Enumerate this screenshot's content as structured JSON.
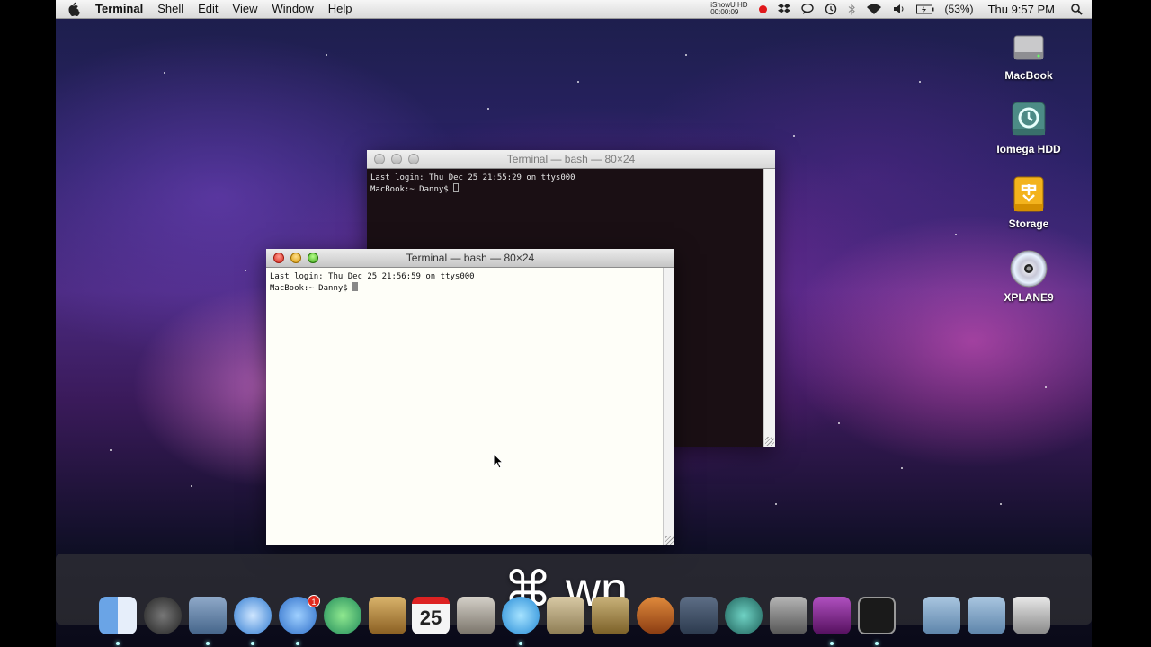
{
  "menubar": {
    "app_name": "Terminal",
    "menus": [
      "Shell",
      "Edit",
      "View",
      "Window",
      "Help"
    ],
    "ishowu_title": "iShowU HD",
    "ishowu_time": "00:00:09",
    "battery": "(53%)",
    "clock": "Thu 9:57 PM"
  },
  "windows": {
    "back": {
      "title": "Terminal — bash — 80×24",
      "lines": [
        "Last login: Thu Dec 25 21:55:29 on ttys000",
        "MacBook:~ Danny$ "
      ]
    },
    "front": {
      "title": "Terminal — bash — 80×24",
      "lines": [
        "Last login: Thu Dec 25 21:56:59 on ttys000",
        "MacBook:~ Danny$ "
      ]
    }
  },
  "desktop_icons": [
    {
      "label": "MacBook",
      "icon": "hard-drive-icon"
    },
    {
      "label": "Iomega HDD",
      "icon": "time-machine-drive-icon"
    },
    {
      "label": "Storage",
      "icon": "firewire-drive-icon"
    },
    {
      "label": "XPLANE9",
      "icon": "dvd-icon"
    }
  ],
  "overlay": {
    "shortcut": "⌘ wn"
  },
  "dock": {
    "ical_date": "25",
    "mail_badge": "1",
    "items": [
      "finder-icon",
      "dashboard-icon",
      "mail-icon",
      "safari-icon",
      "ichat-icon",
      "address-book-icon",
      "notes-icon",
      "ical-icon",
      "iphoto-icon",
      "itunes-icon",
      "preview-icon",
      "xcode-icon",
      "garageband-icon",
      "spaces-icon",
      "time-machine-icon",
      "system-preferences-icon",
      "ishowu-icon",
      "terminal-icon",
      "documents-stack-icon",
      "downloads-stack-icon",
      "trash-icon"
    ]
  },
  "colors": {
    "menubar": "#e8e8e8",
    "back_terminal_bg": "#1a0f14",
    "front_terminal_bg": "#fefef8"
  }
}
